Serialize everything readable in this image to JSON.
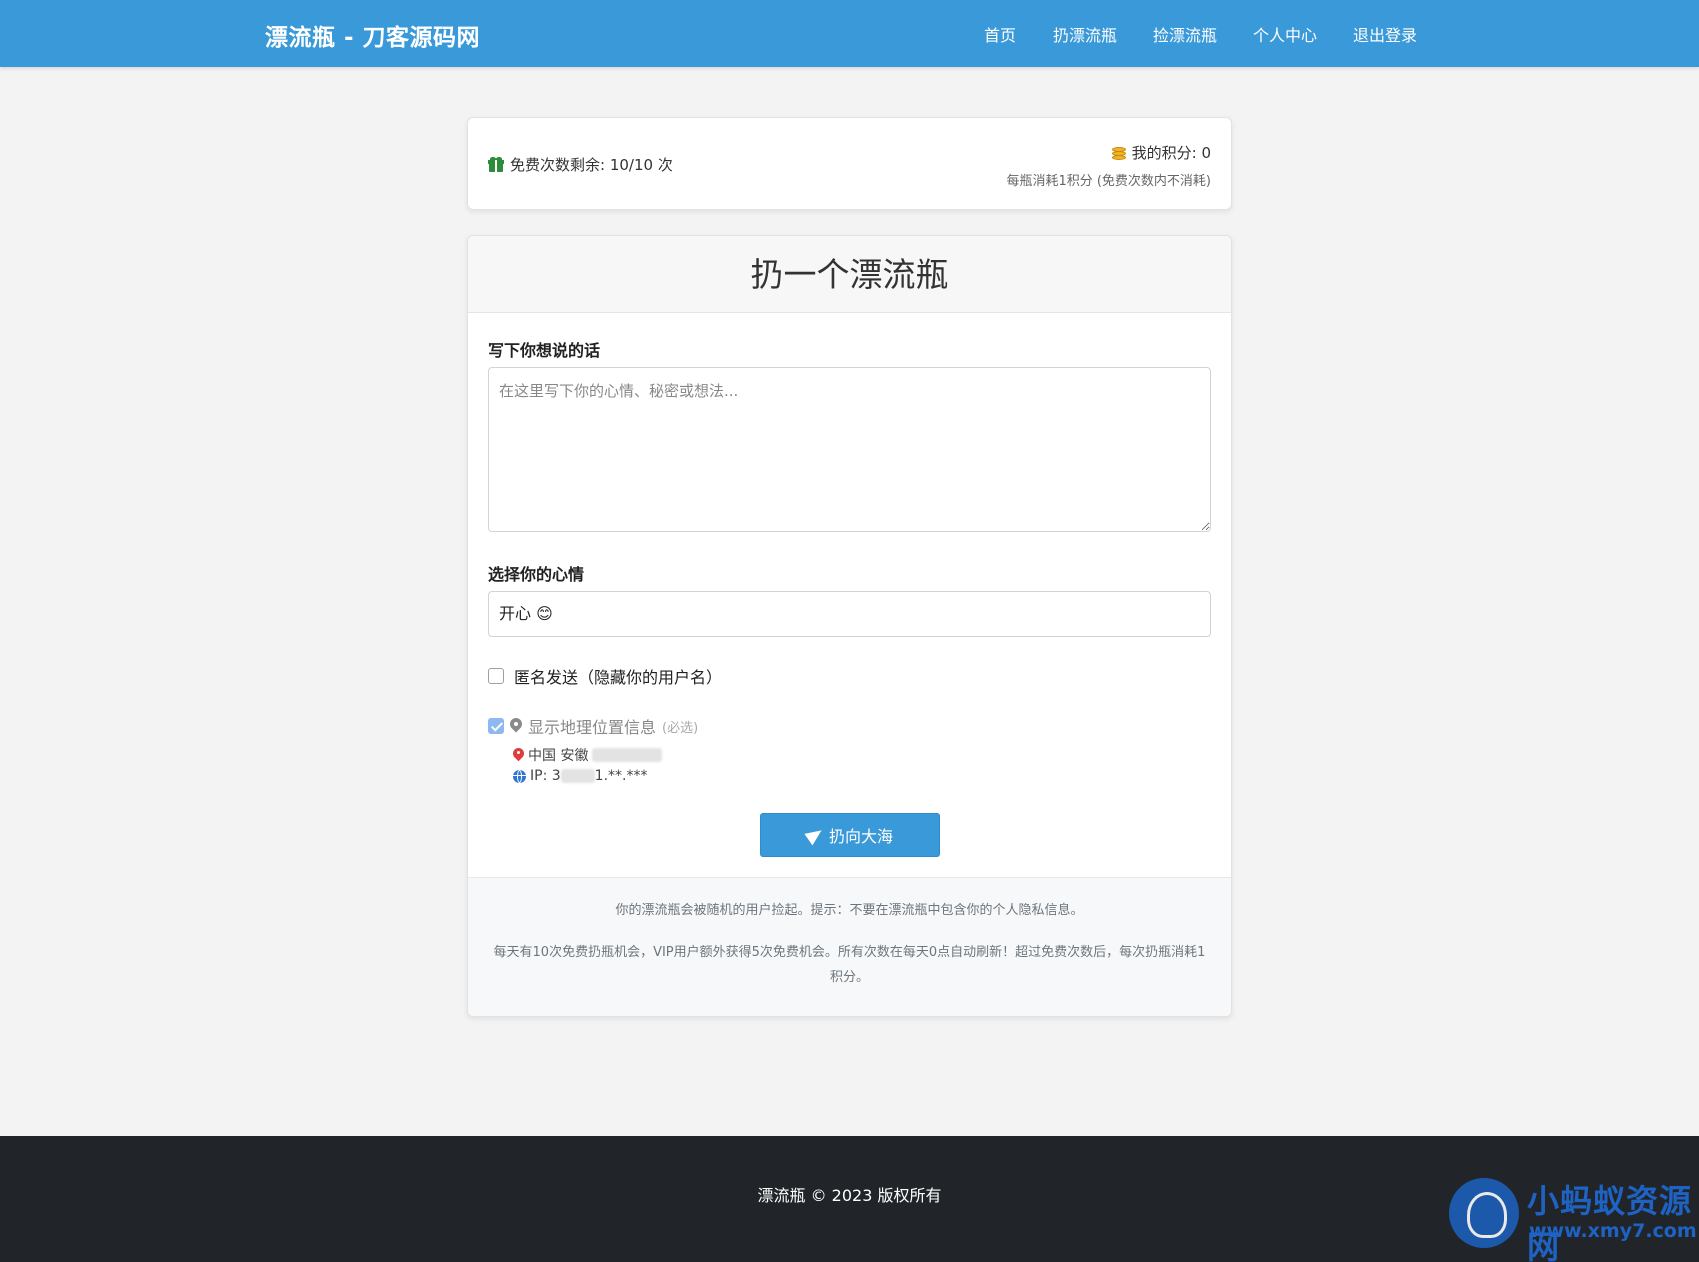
{
  "navbar": {
    "brand": "漂流瓶 - 刀客源码网",
    "links": [
      "首页",
      "扔漂流瓶",
      "捡漂流瓶",
      "个人中心",
      "退出登录"
    ]
  },
  "stats": {
    "free_label": "免费次数剩余: 10/10 次",
    "points_label": "我的积分: 0",
    "points_note": "每瓶消耗1积分 (免费次数内不消耗)"
  },
  "form": {
    "title": "扔一个漂流瓶",
    "message_label": "写下你想说的话",
    "message_placeholder": "在这里写下你的心情、秘密或想法...",
    "mood_label": "选择你的心情",
    "mood_selected": "开心 😊",
    "anonymous_label": "匿名发送（隐藏你的用户名）",
    "location_label": "显示地理位置信息",
    "location_optional": "(必选)",
    "location_value": "中国 安徽",
    "ip_prefix": "IP: 3",
    "ip_suffix": "1.**.***",
    "submit_label": "扔向大海"
  },
  "info": {
    "tip": "你的漂流瓶会被随机的用户捡起。提示：不要在漂流瓶中包含你的个人隐私信息。",
    "rules": "每天有10次免费扔瓶机会，VIP用户额外获得5次免费机会。所有次数在每天0点自动刷新！超过免费次数后，每次扔瓶消耗1积分。"
  },
  "footer": {
    "copyright": "漂流瓶 © 2023 版权所有"
  },
  "watermark": {
    "title": "小蚂蚁资源网",
    "url": "www.xmy7.com"
  },
  "colors": {
    "primary": "#3a9ad9",
    "footer_bg": "#212529",
    "page_bg": "#f3f3f3"
  }
}
